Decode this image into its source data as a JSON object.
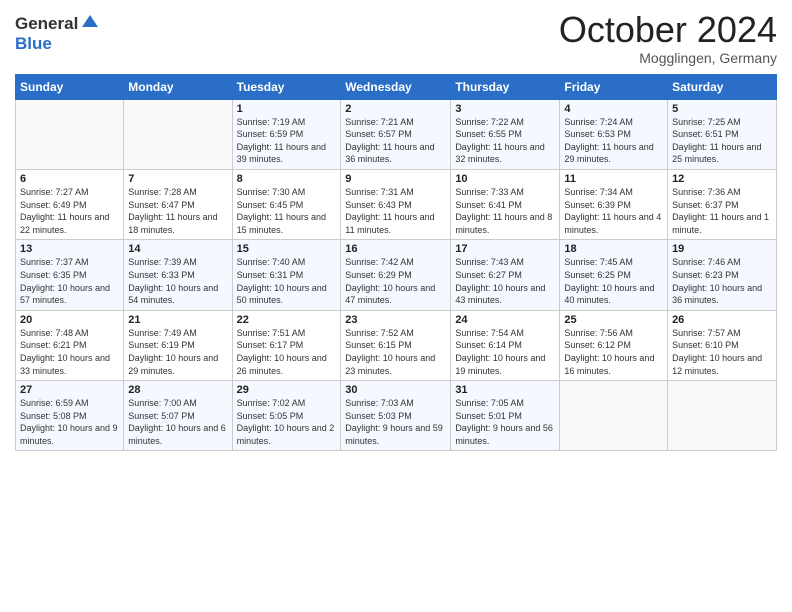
{
  "header": {
    "logo": {
      "general": "General",
      "blue": "Blue"
    },
    "title": "October 2024",
    "location": "Mogglingen, Germany"
  },
  "calendar": {
    "days_of_week": [
      "Sunday",
      "Monday",
      "Tuesday",
      "Wednesday",
      "Thursday",
      "Friday",
      "Saturday"
    ],
    "weeks": [
      [
        {
          "day": "",
          "info": ""
        },
        {
          "day": "",
          "info": ""
        },
        {
          "day": "1",
          "info": "Sunrise: 7:19 AM\nSunset: 6:59 PM\nDaylight: 11 hours and 39 minutes."
        },
        {
          "day": "2",
          "info": "Sunrise: 7:21 AM\nSunset: 6:57 PM\nDaylight: 11 hours and 36 minutes."
        },
        {
          "day": "3",
          "info": "Sunrise: 7:22 AM\nSunset: 6:55 PM\nDaylight: 11 hours and 32 minutes."
        },
        {
          "day": "4",
          "info": "Sunrise: 7:24 AM\nSunset: 6:53 PM\nDaylight: 11 hours and 29 minutes."
        },
        {
          "day": "5",
          "info": "Sunrise: 7:25 AM\nSunset: 6:51 PM\nDaylight: 11 hours and 25 minutes."
        }
      ],
      [
        {
          "day": "6",
          "info": "Sunrise: 7:27 AM\nSunset: 6:49 PM\nDaylight: 11 hours and 22 minutes."
        },
        {
          "day": "7",
          "info": "Sunrise: 7:28 AM\nSunset: 6:47 PM\nDaylight: 11 hours and 18 minutes."
        },
        {
          "day": "8",
          "info": "Sunrise: 7:30 AM\nSunset: 6:45 PM\nDaylight: 11 hours and 15 minutes."
        },
        {
          "day": "9",
          "info": "Sunrise: 7:31 AM\nSunset: 6:43 PM\nDaylight: 11 hours and 11 minutes."
        },
        {
          "day": "10",
          "info": "Sunrise: 7:33 AM\nSunset: 6:41 PM\nDaylight: 11 hours and 8 minutes."
        },
        {
          "day": "11",
          "info": "Sunrise: 7:34 AM\nSunset: 6:39 PM\nDaylight: 11 hours and 4 minutes."
        },
        {
          "day": "12",
          "info": "Sunrise: 7:36 AM\nSunset: 6:37 PM\nDaylight: 11 hours and 1 minute."
        }
      ],
      [
        {
          "day": "13",
          "info": "Sunrise: 7:37 AM\nSunset: 6:35 PM\nDaylight: 10 hours and 57 minutes."
        },
        {
          "day": "14",
          "info": "Sunrise: 7:39 AM\nSunset: 6:33 PM\nDaylight: 10 hours and 54 minutes."
        },
        {
          "day": "15",
          "info": "Sunrise: 7:40 AM\nSunset: 6:31 PM\nDaylight: 10 hours and 50 minutes."
        },
        {
          "day": "16",
          "info": "Sunrise: 7:42 AM\nSunset: 6:29 PM\nDaylight: 10 hours and 47 minutes."
        },
        {
          "day": "17",
          "info": "Sunrise: 7:43 AM\nSunset: 6:27 PM\nDaylight: 10 hours and 43 minutes."
        },
        {
          "day": "18",
          "info": "Sunrise: 7:45 AM\nSunset: 6:25 PM\nDaylight: 10 hours and 40 minutes."
        },
        {
          "day": "19",
          "info": "Sunrise: 7:46 AM\nSunset: 6:23 PM\nDaylight: 10 hours and 36 minutes."
        }
      ],
      [
        {
          "day": "20",
          "info": "Sunrise: 7:48 AM\nSunset: 6:21 PM\nDaylight: 10 hours and 33 minutes."
        },
        {
          "day": "21",
          "info": "Sunrise: 7:49 AM\nSunset: 6:19 PM\nDaylight: 10 hours and 29 minutes."
        },
        {
          "day": "22",
          "info": "Sunrise: 7:51 AM\nSunset: 6:17 PM\nDaylight: 10 hours and 26 minutes."
        },
        {
          "day": "23",
          "info": "Sunrise: 7:52 AM\nSunset: 6:15 PM\nDaylight: 10 hours and 23 minutes."
        },
        {
          "day": "24",
          "info": "Sunrise: 7:54 AM\nSunset: 6:14 PM\nDaylight: 10 hours and 19 minutes."
        },
        {
          "day": "25",
          "info": "Sunrise: 7:56 AM\nSunset: 6:12 PM\nDaylight: 10 hours and 16 minutes."
        },
        {
          "day": "26",
          "info": "Sunrise: 7:57 AM\nSunset: 6:10 PM\nDaylight: 10 hours and 12 minutes."
        }
      ],
      [
        {
          "day": "27",
          "info": "Sunrise: 6:59 AM\nSunset: 5:08 PM\nDaylight: 10 hours and 9 minutes."
        },
        {
          "day": "28",
          "info": "Sunrise: 7:00 AM\nSunset: 5:07 PM\nDaylight: 10 hours and 6 minutes."
        },
        {
          "day": "29",
          "info": "Sunrise: 7:02 AM\nSunset: 5:05 PM\nDaylight: 10 hours and 2 minutes."
        },
        {
          "day": "30",
          "info": "Sunrise: 7:03 AM\nSunset: 5:03 PM\nDaylight: 9 hours and 59 minutes."
        },
        {
          "day": "31",
          "info": "Sunrise: 7:05 AM\nSunset: 5:01 PM\nDaylight: 9 hours and 56 minutes."
        },
        {
          "day": "",
          "info": ""
        },
        {
          "day": "",
          "info": ""
        }
      ]
    ]
  }
}
